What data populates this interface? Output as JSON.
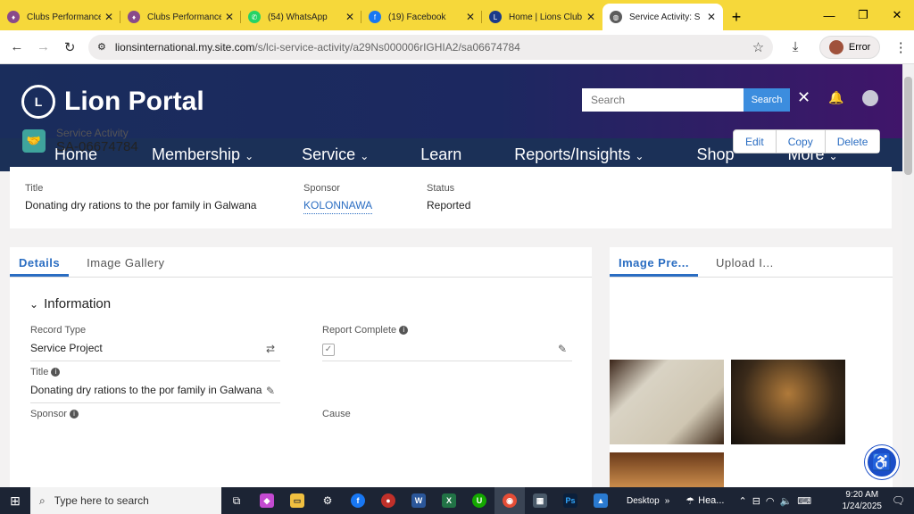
{
  "browser": {
    "tabs": [
      {
        "title": "Clubs Performance",
        "fav_color": "#8a4a8a"
      },
      {
        "title": "Clubs Performance",
        "fav_color": "#8a4a8a"
      },
      {
        "title": "(54) WhatsApp",
        "fav_color": "#25d366"
      },
      {
        "title": "(19) Facebook",
        "fav_color": "#1877f2"
      },
      {
        "title": "Home | Lions Club",
        "fav_color": "#1b3a8a"
      },
      {
        "title": "Service Activity: S",
        "fav_color": "#5c5c5c"
      }
    ],
    "url_host": "lionsinternational.my.site.com",
    "url_path": "/s/lci-service-activity/a29Ns000006rIGHIA2/sa06674784",
    "profile_label": "Error"
  },
  "portal": {
    "logo_text": "Lion Portal",
    "search_placeholder": "Search",
    "search_button": "Search",
    "nav": [
      "Home",
      "Membership",
      "Service",
      "Learn",
      "Reports/Insights",
      "Shop",
      "More"
    ]
  },
  "record": {
    "type": "Service Activity",
    "id": "SA-06674784",
    "actions": [
      "Edit",
      "Copy",
      "Delete"
    ],
    "highlights": {
      "title_label": "Title",
      "title_value": "Donating dry rations to the por family in Galwana",
      "sponsor_label": "Sponsor",
      "sponsor_value": "KOLONNAWA",
      "status_label": "Status",
      "status_value": "Reported"
    },
    "tabs": [
      "Details",
      "Image Gallery"
    ],
    "section": "Information",
    "fields": {
      "record_type_label": "Record Type",
      "record_type_value": "Service Project",
      "report_complete_label": "Report Complete",
      "title_label": "Title",
      "title_value": "Donating dry rations to the por family in Galwana",
      "sponsor_label": "Sponsor",
      "cause_label": "Cause"
    },
    "side_tabs": [
      "Image Pre...",
      "Upload I..."
    ]
  },
  "taskbar": {
    "search_placeholder": "Type here to search",
    "desktop_label": "Desktop",
    "weather_label": "Hea...",
    "time": "9:20 AM",
    "date": "1/24/2025"
  }
}
